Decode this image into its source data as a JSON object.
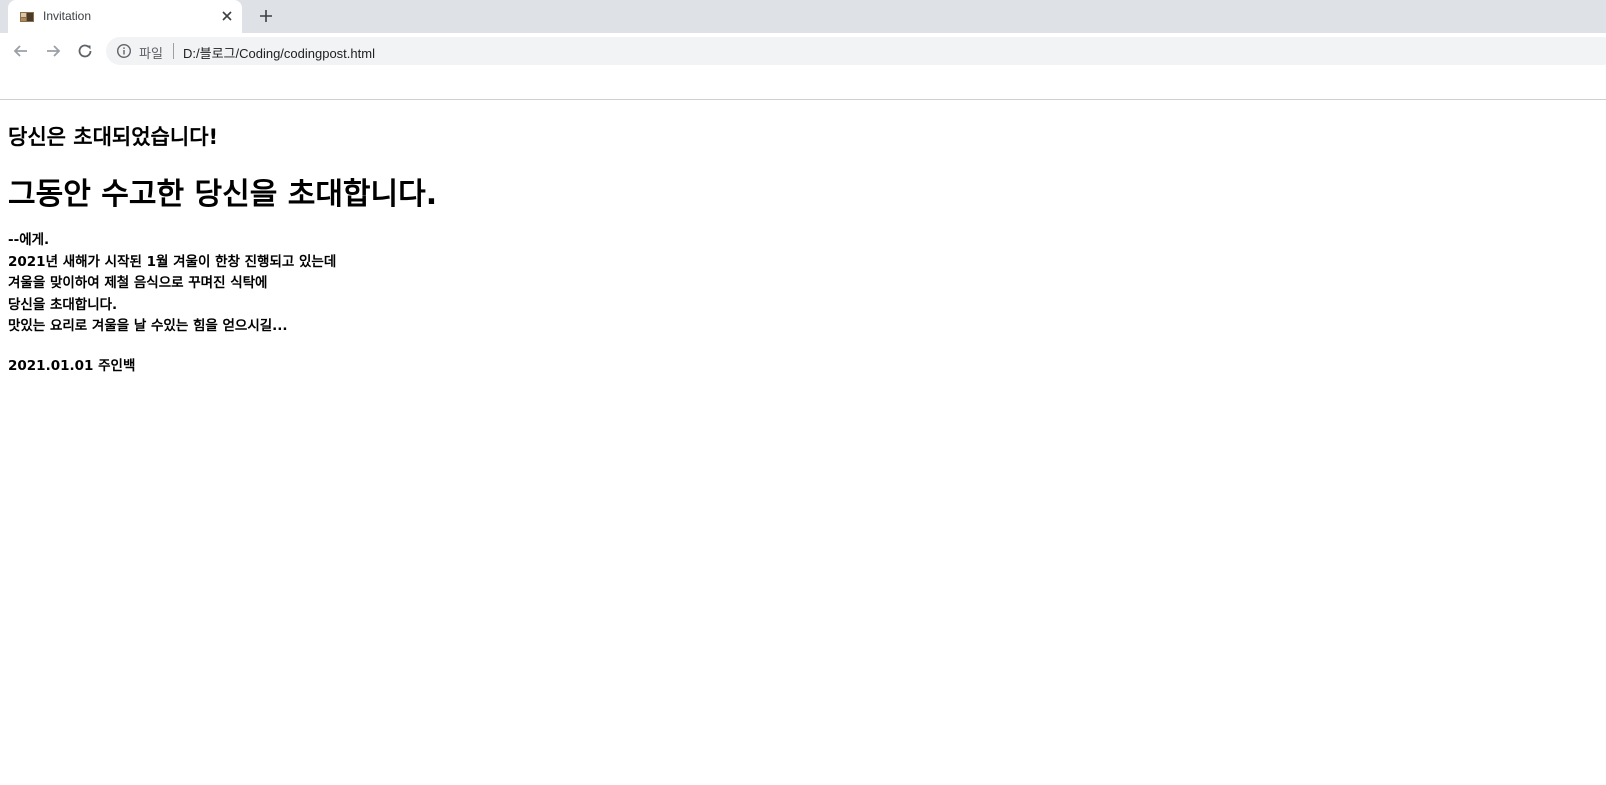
{
  "browser": {
    "tab_title": "Invitation",
    "scheme_label": "파일",
    "url": "D:/블로그/Coding/codingpost.html"
  },
  "page": {
    "subtitle": "당신은 초대되었습니다!",
    "title": "그동안 수고한 당신을 초대합니다.",
    "letter_lines": [
      "--에게.",
      "2021년 새해가 시작된 1월 겨울이 한창 진행되고 있는데",
      "겨울을 맞이하여 제철 음식으로 꾸며진 식탁에",
      "당신을 초대합니다.",
      "맛있는 요리로 겨울을 날 수있는 힘을 얻으시길..."
    ],
    "signature": "2021.01.01 주인백"
  }
}
